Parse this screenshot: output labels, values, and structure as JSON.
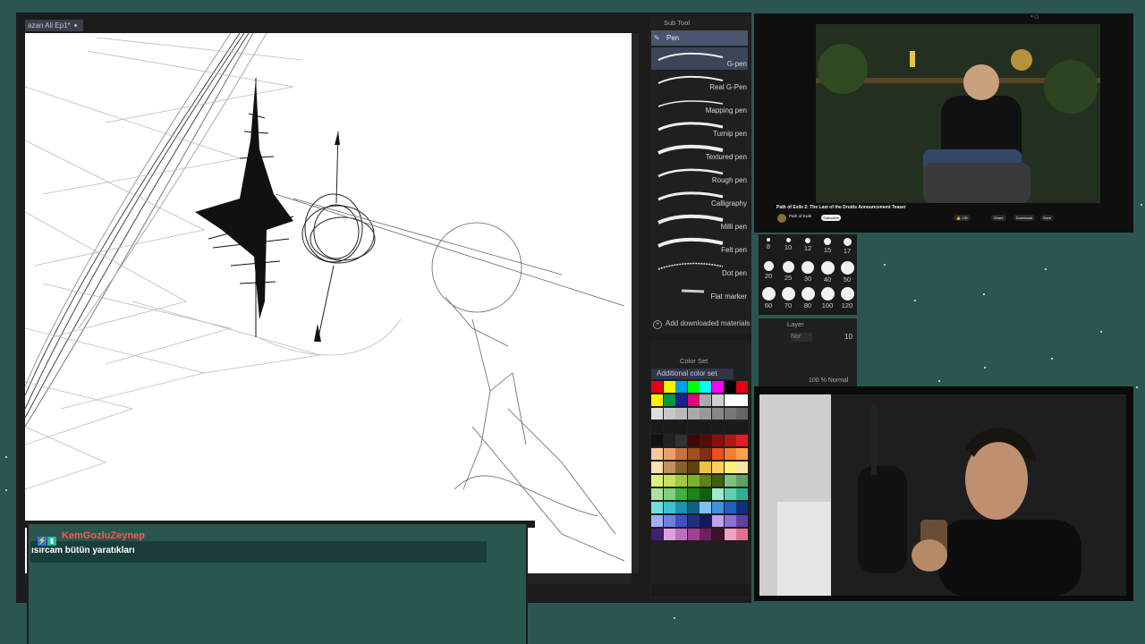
{
  "canvas": {
    "doc_tab_title": "azan Ali Ep1*"
  },
  "subtool": {
    "header": "Sub Tool",
    "group": "Pen",
    "brushes": [
      {
        "label": "G-pen",
        "selected": true
      },
      {
        "label": "Real G-Pen"
      },
      {
        "label": "Mapping pen"
      },
      {
        "label": "Turnip pen"
      },
      {
        "label": "Textured pen"
      },
      {
        "label": "Rough pen"
      },
      {
        "label": "Calligraphy"
      },
      {
        "label": "Milli pen"
      },
      {
        "label": "Felt pen"
      },
      {
        "label": "Dot pen"
      },
      {
        "label": "Flat marker"
      }
    ],
    "add_downloaded": "Add downloaded materials"
  },
  "brush_sizes": {
    "row1": [
      "8",
      "10",
      "12",
      "15",
      "17"
    ],
    "row2": [
      "20",
      "25",
      "30",
      "40",
      "50"
    ],
    "row3": [
      "60",
      "70",
      "80",
      "100",
      "120"
    ]
  },
  "layer": {
    "title": "Layer",
    "blend": "Nor",
    "opacity": "10",
    "row_text": "100 % Normal"
  },
  "colorset": {
    "header": "Color Set",
    "selected_set": "Additional color set",
    "swatches": [
      [
        "#e60012",
        "#fff100",
        "#00a0e9",
        "#00ff00",
        "#00ffff",
        "#ff00ff",
        "#000000",
        "#e60012"
      ],
      [
        "#fff200",
        "#009944",
        "#1d2088",
        "#e4007f",
        "#aaaaaa",
        "#d0d0d0",
        "#ffffff",
        "#ffffff"
      ],
      [
        "#dddddd",
        "#c8c8c8",
        "#bbbbbb",
        "#aaaaaa",
        "#999999",
        "#888888",
        "#777777",
        "#666666"
      ],
      [
        "#1a1a1a",
        "#1a1a1a",
        "#1a1a1a",
        "#1a1a1a",
        "#1a1a1a",
        "#1a1a1a",
        "#1a1a1a",
        "#1a1a1a"
      ],
      [
        "#111111",
        "#222222",
        "#333333",
        "#3a0a0a",
        "#5a0a0a",
        "#8a1010",
        "#b01818",
        "#e02020"
      ],
      [
        "#f7c8a0",
        "#e8a070",
        "#c87040",
        "#a05020",
        "#803010",
        "#e85020",
        "#f08030",
        "#f8a050"
      ],
      [
        "#ffe0b0",
        "#c09060",
        "#806030",
        "#604010",
        "#f0c040",
        "#f8d060",
        "#fff080",
        "#f8e8a0"
      ],
      [
        "#e0f080",
        "#c8e060",
        "#a0c840",
        "#80b030",
        "#608020",
        "#406010",
        "#80c080",
        "#60a060"
      ],
      [
        "#b0e0a0",
        "#80d080",
        "#40b040",
        "#208020",
        "#106010",
        "#a0e8d0",
        "#60d0b0",
        "#30b090"
      ],
      [
        "#70e0e0",
        "#40c0d0",
        "#2090b0",
        "#106080",
        "#80c0f0",
        "#4090e0",
        "#2060c0",
        "#103080"
      ],
      [
        "#a0b0f0",
        "#7080e0",
        "#4050c0",
        "#203080",
        "#101860",
        "#c0a0f0",
        "#9070d0",
        "#6040a0"
      ],
      [
        "#402070",
        "#e0a0e0",
        "#c070c0",
        "#a04090",
        "#702060",
        "#401030",
        "#f0a0c0",
        "#e07090"
      ]
    ]
  },
  "youtube": {
    "video_title": "Path of Exile 2: The Last of the Druids Announcement Teaser",
    "channel_name": "Path of Exile",
    "subscribe_label": "Subscribe",
    "likes": "13K",
    "share_label": "Share",
    "download_label": "Download",
    "save_label": "Save"
  },
  "chat": {
    "username": "KemGozluZeynep",
    "username_color": "#ff5555",
    "message": "ısırcam bütün yaratıkları"
  }
}
